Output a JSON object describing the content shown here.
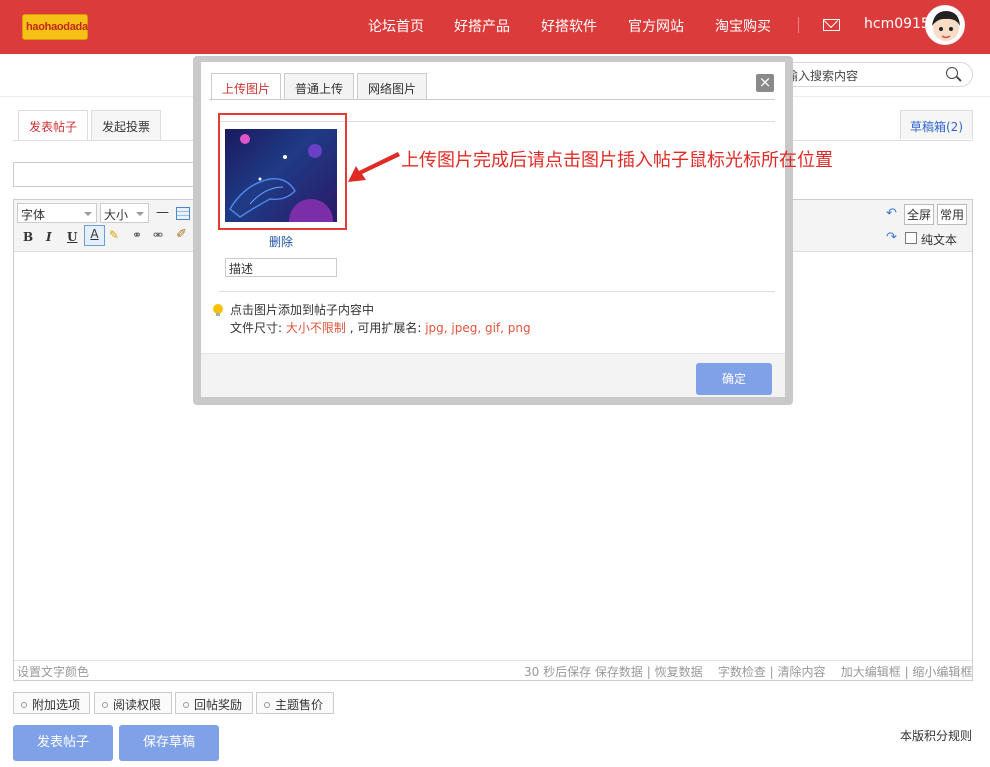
{
  "header": {
    "logo_text": "haohaodada",
    "nav": [
      "论坛首页",
      "好搭产品",
      "好搭软件",
      "官方网站",
      "淘宝购买"
    ],
    "username": "hcm0915"
  },
  "search": {
    "placeholder": "输入搜索内容",
    "display": "输入搜索内容"
  },
  "editor": {
    "tabs": [
      "发表帖子",
      "发起投票"
    ],
    "draft_box": "草稿箱(2)",
    "font_select": "字体",
    "size_select": "大小",
    "fullscreen": "全屏",
    "common": "常用",
    "plain_text": "纯文本",
    "status_left": "设置文字颜色",
    "status_right": "30 秒后保存 保存数据 | 恢复数据    字数检查 | 清除内容    加大编辑框 | 缩小编辑框",
    "options": [
      "附加选项",
      "阅读权限",
      "回帖奖励",
      "主题售价"
    ],
    "buttons": {
      "publish": "发表帖子",
      "save_draft": "保存草稿"
    },
    "rules": "本版积分规则"
  },
  "modal": {
    "tabs": [
      "上传图片",
      "普通上传",
      "网络图片"
    ],
    "close": "×",
    "delete": "删除",
    "desc_value": "描述",
    "tip1": "点击图片添加到帖子内容中",
    "tip2_prefix": "文件尺寸: ",
    "tip2_size": "大小不限制",
    "tip2_mid": " , 可用扩展名: ",
    "tip2_ext": "jpg, jpeg, gif, png",
    "ok": "确定"
  },
  "annotation": "上传图片完成后请点击图片插入帖子鼠标光标所在位置",
  "colors": {
    "header": "#dc3b3b",
    "button": "#7fa1e8",
    "annotation": "#e02b25"
  }
}
